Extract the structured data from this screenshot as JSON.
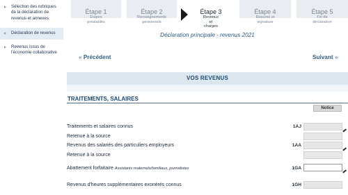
{
  "sidebar": {
    "items": [
      {
        "label": "Sélection des rubriques de la déclaration de revenus et annexes"
      },
      {
        "label": "Déclaration de revenus"
      },
      {
        "label": "Revenus issus de l'économie collaborative"
      }
    ]
  },
  "steps": [
    {
      "title": "Étape 1",
      "subtitle": "Étapes préalables"
    },
    {
      "title": "Étape 2",
      "subtitle": "Renseignements personnels"
    },
    {
      "title": "Étape 3",
      "subtitle": "Revenus et charges"
    },
    {
      "title": "Étape 4",
      "subtitle": "Résumé et signature"
    },
    {
      "title": "Étape 5",
      "subtitle": "Fin de déclaration"
    }
  ],
  "active_step": 3,
  "page_heading": "Déclaration principale - revenus 2021",
  "nav": {
    "prev": "Précédent",
    "next": "Suivant",
    "prev_arrow": "«",
    "next_arrow": "»"
  },
  "section_title": "VOS REVENUS",
  "subsection_title": "TRAITEMENTS, SALAIRES",
  "notice_label": "Notice",
  "rows": [
    {
      "label": "Traitements et salaires connus",
      "code": "1AJ",
      "value": ""
    },
    {
      "label": "Retenue à la source",
      "code": "",
      "value": ""
    },
    {
      "label": "Revenus des salariés des particuliers employeurs",
      "code": "1AA",
      "value": ""
    },
    {
      "label": "Retenue à la source",
      "code": "",
      "value": ""
    },
    {
      "label": "Abattement forfaitaire",
      "hint": "Assistants maternels/familiaux, journalistes",
      "code": "1GA",
      "value": ""
    },
    {
      "label": "Revenus d'heures supplémentaires exonérés connus",
      "code": "1GH",
      "value": ""
    }
  ],
  "colors": {
    "accent": "#2f5c86",
    "band": "#dde7ef",
    "field": "#e7e7e7"
  }
}
